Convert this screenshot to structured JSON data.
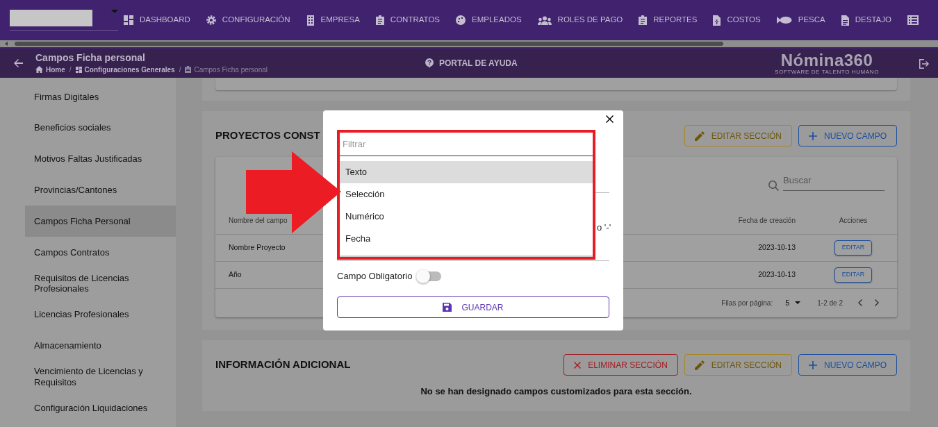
{
  "topnav": {
    "items": [
      {
        "label": "DASHBOARD"
      },
      {
        "label": "CONFIGURACIÓN"
      },
      {
        "label": "EMPRESA"
      },
      {
        "label": "CONTRATOS"
      },
      {
        "label": "EMPLEADOS"
      },
      {
        "label": "ROLES DE PAGO"
      },
      {
        "label": "REPORTES"
      },
      {
        "label": "COSTOS"
      },
      {
        "label": "PESCA"
      },
      {
        "label": "DESTAJO"
      }
    ]
  },
  "header": {
    "title": "Campos Ficha personal",
    "breadcrumbs": [
      {
        "label": "Home"
      },
      {
        "label": "Configuraciones Generales"
      },
      {
        "label": "Campos Ficha personal"
      }
    ],
    "separator": "/",
    "help": "PORTAL DE AYUDA",
    "logo": "Nómina360",
    "logo_tagline": "SOFTWARE DE TALENTO HUMANO"
  },
  "sidebar": {
    "items": [
      {
        "label": "Firmas Digitales",
        "selected": false
      },
      {
        "label": "Beneficios sociales",
        "selected": false
      },
      {
        "label": "Motivos Faltas Justificadas",
        "selected": false
      },
      {
        "label": "Provincias/Cantones",
        "selected": false
      },
      {
        "label": "Campos Ficha Personal",
        "selected": true
      },
      {
        "label": "Campos Contratos",
        "selected": false
      },
      {
        "label": "Requisitos de Licencias Profesionales",
        "selected": false
      },
      {
        "label": "Licencias Profesionales",
        "selected": false
      },
      {
        "label": "Almacenamiento",
        "selected": false
      },
      {
        "label": "Vencimiento de Licencias y Requisitos",
        "selected": false
      },
      {
        "label": "Configuración Liquidaciones",
        "selected": false
      }
    ]
  },
  "sections": [
    {
      "title": "PROYECTOS CONST",
      "buttons": [
        {
          "kind": "edit",
          "label": "EDITAR SECCIÓN"
        },
        {
          "kind": "add",
          "label": "NUEVO CAMPO"
        }
      ],
      "table": {
        "search_placeholder": "Buscar",
        "columns": [
          "Nombre del campo",
          "Fecha de creación",
          "Acciones"
        ],
        "rows": [
          {
            "name": "Nombre Proyecto",
            "date": "2023-10-13",
            "action": "EDITAR"
          },
          {
            "name": "Año",
            "date": "2023-10-13",
            "action": "EDITAR"
          }
        ],
        "footer": {
          "rows_label": "Filas por página:",
          "rows_value": "5",
          "range": "1-2 de 2"
        }
      }
    },
    {
      "title": "INFORMACIÓN ADICIONAL",
      "buttons": [
        {
          "kind": "delete",
          "label": "ELIMINAR SECCIÓN"
        },
        {
          "kind": "edit",
          "label": "EDITAR SECCIÓN"
        },
        {
          "kind": "add",
          "label": "NUEVO CAMPO"
        }
      ],
      "empty_message": "No se han designado campos customizados para esta sección."
    }
  ],
  "modal": {
    "filter_placeholder": "Filtrar",
    "options": [
      {
        "label": "Texto",
        "selected": true
      },
      {
        "label": "Selección",
        "selected": false
      },
      {
        "label": "Numérico",
        "selected": false
      },
      {
        "label": "Fecha",
        "selected": false
      }
    ],
    "hidden_field_text": "o '-'",
    "toggle": {
      "label": "Campo Obligatorio",
      "on": false
    },
    "save": "GUARDAR"
  }
}
